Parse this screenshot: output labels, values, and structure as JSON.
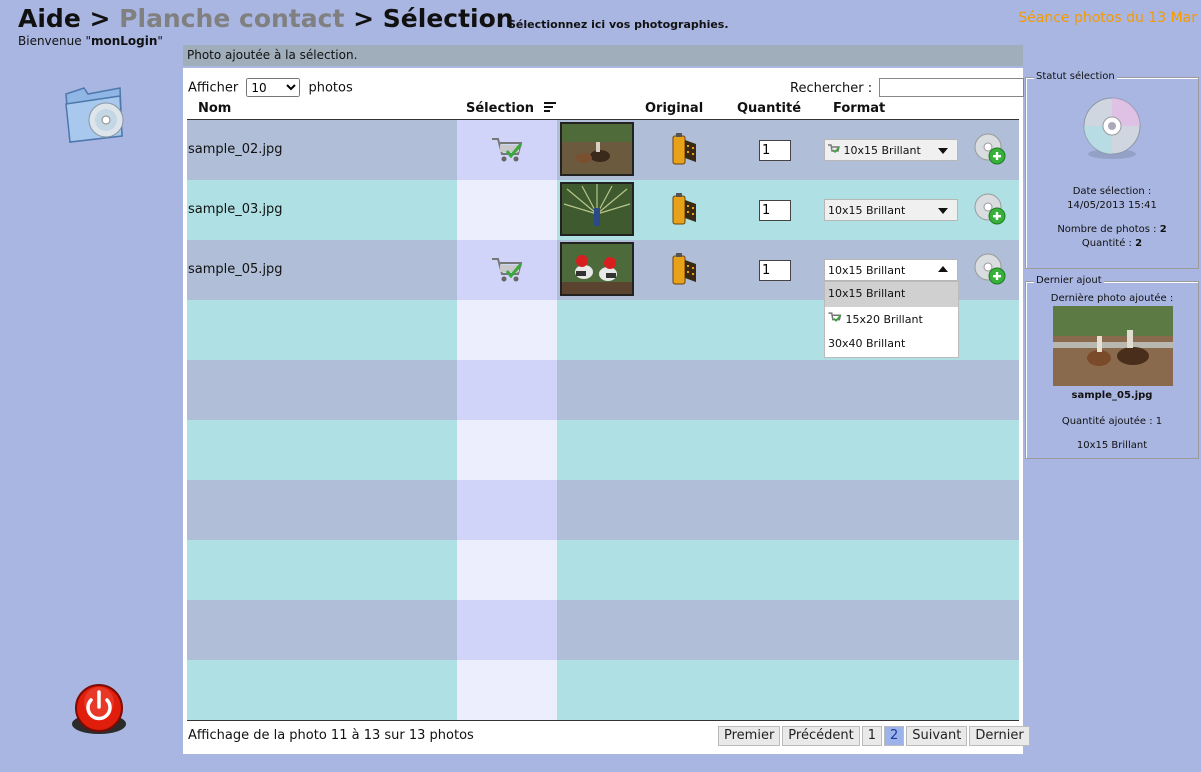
{
  "header": {
    "crumb_aide": "Aide",
    "sep1": ">",
    "crumb_planche": "Planche contact",
    "sep2": ">",
    "crumb_selection": "Sélection",
    "subtitle": "Sélectionnez ici vos photographies.",
    "welcome_prefix": "Bienvenue \"",
    "login": "monLogin",
    "welcome_suffix": "\"",
    "session": "Séance photos du 13 Mar"
  },
  "notice": "Photo ajoutée à la sélection.",
  "table": {
    "show_label": "Afficher",
    "show_value": "10",
    "show_suffix": "photos",
    "search_label": "Rechercher :",
    "search_value": "",
    "columns": {
      "nom": "Nom",
      "selection": "Sélection",
      "original": "Original",
      "quantite": "Quantité",
      "format": "Format"
    },
    "rows": [
      {
        "name": "sample_02.jpg",
        "selected": true,
        "qty": "1",
        "format": "10x15 Brillant",
        "format_has_cart": true
      },
      {
        "name": "sample_03.jpg",
        "selected": false,
        "qty": "1",
        "format": "10x15 Brillant",
        "format_has_cart": false
      },
      {
        "name": "sample_05.jpg",
        "selected": true,
        "qty": "1",
        "format": "10x15 Brillant",
        "format_has_cart": false
      }
    ],
    "dropdown_options": [
      "10x15 Brillant",
      "15x20 Brillant",
      "30x40 Brillant"
    ],
    "footer_info": "Affichage de la photo 11 à 13 sur 13 photos",
    "pager": {
      "first": "Premier",
      "prev": "Précédent",
      "page1": "1",
      "page2": "2",
      "next": "Suivant",
      "last": "Dernier"
    }
  },
  "status_panel": {
    "legend": "Statut sélection",
    "date_label": "Date sélection :",
    "date_value": "14/05/2013 15:41",
    "count_label": "Nombre de photos :",
    "count_value": "2",
    "qty_label": "Quantité :",
    "qty_value": "2"
  },
  "last_panel": {
    "legend": "Dernier ajout",
    "title": "Dernière photo ajoutée :",
    "filename": "sample_05.jpg",
    "qty_text": "Quantité ajoutée : 1",
    "format": "10x15 Brillant"
  },
  "colors": {
    "background": "#a9b6e2",
    "session_accent": "#f59a00",
    "row_odd": "#b0bed8",
    "row_even": "#afe0e4",
    "current_page": "#9bb3e8"
  },
  "icons": [
    "folder-cd-icon",
    "cart-check-icon",
    "film-roll-icon",
    "cd-add-icon",
    "cd-icon",
    "power-icon",
    "sort-icon",
    "chevron-down-icon"
  ]
}
